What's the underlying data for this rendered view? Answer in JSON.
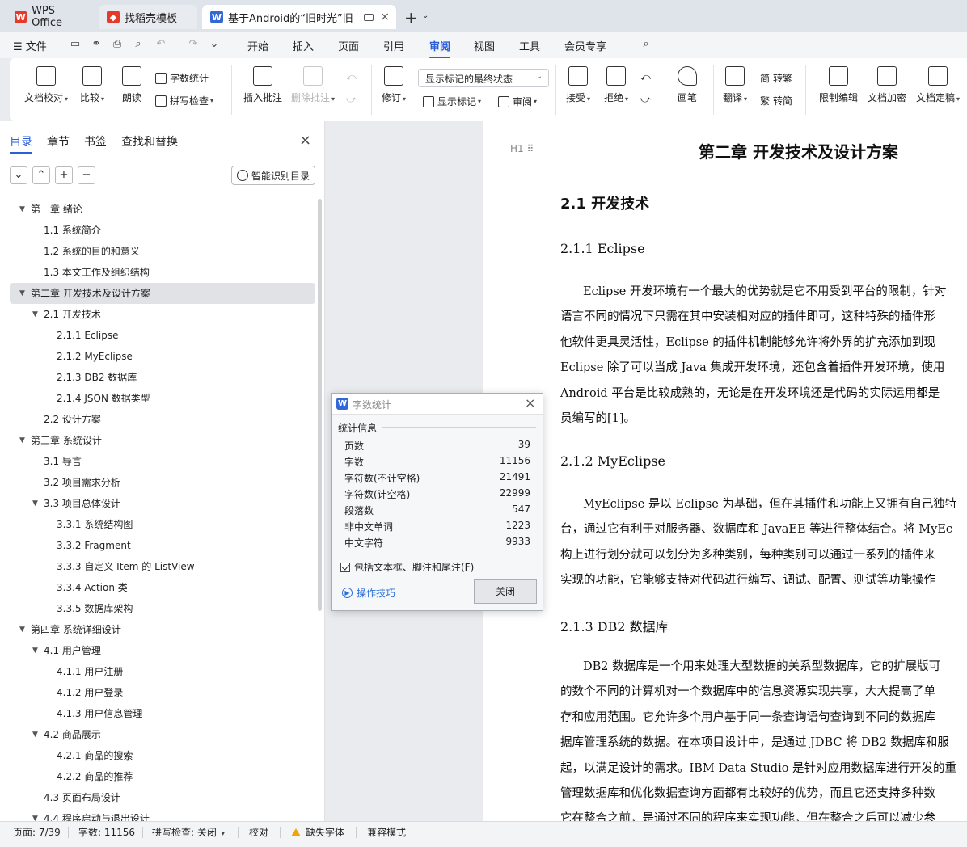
{
  "tabs": [
    {
      "label": "WPS Office",
      "icon": "wps-logo-icon",
      "color": "#e5392a"
    },
    {
      "label": "找稻壳模板",
      "icon": "docer-logo-icon",
      "color": "#e5392a"
    },
    {
      "label": "基于Android的“旧时光”旧",
      "icon": "word-doc-icon",
      "color": "#3367d6"
    }
  ],
  "menu": {
    "file": "文件",
    "items": [
      "开始",
      "插入",
      "页面",
      "引用",
      "审阅",
      "视图",
      "工具",
      "会员专享"
    ],
    "active": "审阅"
  },
  "ribbon": {
    "doc_proof": "文档校对",
    "compare": "比较",
    "read_aloud": "朗读",
    "word_count": "字数统计",
    "spell_check": "拼写检查",
    "insert_comment": "插入批注",
    "delete_comment": "删除批注",
    "revise": "修订",
    "display_state": "显示标记的最终状态",
    "show_marks": "显示标记",
    "review": "审阅",
    "accept": "接受",
    "reject": "拒绝",
    "pen": "画笔",
    "translate": "翻译",
    "to_traditional": "转繁",
    "to_simplified": "转简",
    "restrict_edit": "限制编辑",
    "doc_encrypt": "文档加密",
    "doc_finalize": "文档定稿"
  },
  "panel": {
    "tabs": [
      "目录",
      "章节",
      "书签",
      "查找和替换"
    ],
    "smart_toc": "智能识别目录",
    "toc": [
      {
        "label": "第一章   绪论",
        "level": 1,
        "expanded": true
      },
      {
        "label": "1.1 系统简介",
        "level": 2
      },
      {
        "label": "1.2 系统的目的和意义",
        "level": 2
      },
      {
        "label": "1.3 本文工作及组织结构",
        "level": 2
      },
      {
        "label": "第二章  开发技术及设计方案",
        "level": 1,
        "expanded": true,
        "selected": true
      },
      {
        "label": "2.1  开发技术",
        "level": 2,
        "expanded": true
      },
      {
        "label": "2.1.1 Eclipse",
        "level": 3
      },
      {
        "label": "2.1.2 MyEclipse",
        "level": 3
      },
      {
        "label": "2.1.3 DB2 数据库",
        "level": 3
      },
      {
        "label": "2.1.4 JSON 数据类型",
        "level": 3
      },
      {
        "label": "2.2 设计方案",
        "level": 2
      },
      {
        "label": "第三章  系统设计",
        "level": 1,
        "expanded": true
      },
      {
        "label": "3.1 导言",
        "level": 2
      },
      {
        "label": "3.2 项目需求分析",
        "level": 2
      },
      {
        "label": "3.3 项目总体设计",
        "level": 2,
        "expanded": true
      },
      {
        "label": "3.3.1 系统结构图",
        "level": 3
      },
      {
        "label": "3.3.2 Fragment",
        "level": 3
      },
      {
        "label": "3.3.3 自定义 Item 的 ListView",
        "level": 3
      },
      {
        "label": "3.3.4 Action 类",
        "level": 3
      },
      {
        "label": "3.3.5  数据库架构",
        "level": 3
      },
      {
        "label": "第四章  系统详细设计",
        "level": 1,
        "expanded": true
      },
      {
        "label": "4.1  用户管理",
        "level": 2,
        "expanded": true
      },
      {
        "label": "4.1.1 用户注册",
        "level": 3
      },
      {
        "label": "4.1.2 用户登录",
        "level": 3
      },
      {
        "label": "4.1.3  用户信息管理",
        "level": 3
      },
      {
        "label": "4.2  商品展示",
        "level": 2,
        "expanded": true
      },
      {
        "label": "4.2.1 商品的搜索",
        "level": 3
      },
      {
        "label": "4.2.2 商品的推荐",
        "level": 3
      },
      {
        "label": "4.3  页面布局设计",
        "level": 2
      },
      {
        "label": "4.4  程序启动与退出设计",
        "level": 2,
        "expanded": true
      }
    ]
  },
  "document": {
    "chapter_title": "第二章  开发技术及设计方案",
    "heading_marker": "H1",
    "section": "2.1  开发技术",
    "s1_title": "2.1.1 Eclipse",
    "s1_lines": [
      "Eclipse 开发环境有一个最大的优势就是它不用受到平台的限制，针对",
      "语言不同的情况下只需在其中安装相对应的插件即可，这种特殊的插件形",
      "他软件更具灵活性，Eclipse 的插件机制能够允许将外界的扩充添加到现",
      "Eclipse 除了可以当成 Java 集成开发环境，还包含着插件开发环境，使用",
      "Android 平台是比较成熟的，无论是在开发环境还是代码的实际运用都是",
      "员编写的[1]。"
    ],
    "s2_title": "2.1.2 MyEclipse",
    "s2_lines": [
      "MyEclipse 是以 Eclipse 为基础，但在其插件和功能上又拥有自己独特",
      "台，通过它有利于对服务器、数据库和 JavaEE 等进行整体结合。将 MyEc",
      "构上进行划分就可以划分为多种类别，每种类别可以通过一系列的插件来",
      "实现的功能，它能够支持对代码进行编写、调试、配置、测试等功能操作"
    ],
    "s3_title": "2.1.3 DB2 数据库",
    "s3_lines": [
      "DB2 数据库是一个用来处理大型数据的关系型数据库，它的扩展版可",
      "的数个不同的计算机对一个数据库中的信息资源实现共享，大大提高了单",
      "存和应用范围。它允许多个用户基于同一条查询语句查询到不同的数据库",
      "据库管理系统的数据。在本项目设计中，是通过 JDBC 将 DB2 数据库和服",
      "起，以满足设计的需求。IBM Data Studio 是针对应用数据库进行开发的重",
      "管理数据库和优化数据查询方面都有比较好的优势，而且它还支持多种数",
      "它在整合之前，是通过不同的程序来实现功能，但在整合之后可以减少参"
    ]
  },
  "dialog": {
    "title": "字数统计",
    "section": "统计信息",
    "rows": [
      {
        "k": "页数",
        "v": "39"
      },
      {
        "k": "字数",
        "v": "11156"
      },
      {
        "k": "字符数(不计空格)",
        "v": "21491"
      },
      {
        "k": "字符数(计空格)",
        "v": "22999"
      },
      {
        "k": "段落数",
        "v": "547"
      },
      {
        "k": "非中文单词",
        "v": "1223"
      },
      {
        "k": "中文字符",
        "v": "9933"
      }
    ],
    "checkbox": "包括文本框、脚注和尾注(F)",
    "checked": true,
    "tips": "操作技巧",
    "close": "关闭"
  },
  "status": {
    "page": "页面: 7/39",
    "words": "字数: 11156",
    "spell": "拼写检查: 关闭",
    "proof": "校对",
    "missing_font": "缺失字体",
    "compat": "兼容模式"
  }
}
